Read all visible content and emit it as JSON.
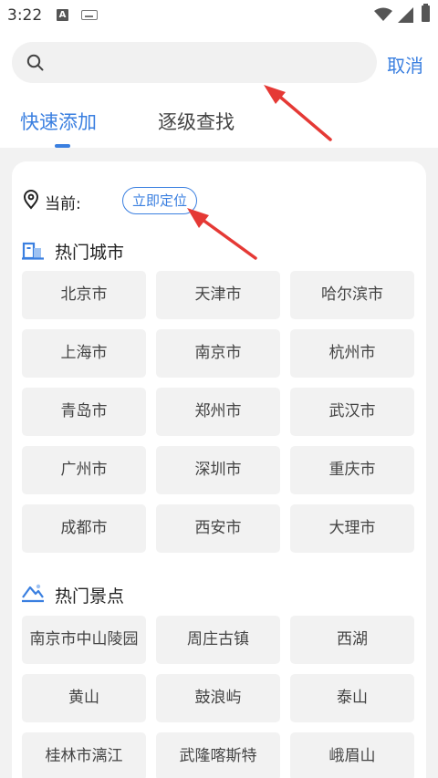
{
  "status_bar": {
    "time": "3:22",
    "notification_icon": "A"
  },
  "search": {
    "placeholder": "",
    "cancel_label": "取消"
  },
  "tabs": [
    {
      "label": "快速添加",
      "active": true
    },
    {
      "label": "逐级查找",
      "active": false
    }
  ],
  "location": {
    "label": "当前:",
    "locate_button": "立即定位"
  },
  "hot_cities": {
    "title": "热门城市",
    "items": [
      "北京市",
      "天津市",
      "哈尔滨市",
      "上海市",
      "南京市",
      "杭州市",
      "青岛市",
      "郑州市",
      "武汉市",
      "广州市",
      "深圳市",
      "重庆市",
      "成都市",
      "西安市",
      "大理市"
    ]
  },
  "hot_spots": {
    "title": "热门景点",
    "items": [
      "南京市中山陵园",
      "周庄古镇",
      "西湖",
      "黄山",
      "鼓浪屿",
      "泰山",
      "桂林市漓江",
      "武隆喀斯特",
      "峨眉山"
    ]
  },
  "colors": {
    "accent": "#3a7fe0",
    "annotation_arrow": "#e53935"
  },
  "icons": [
    "search-icon",
    "location-pin-icon",
    "building-icon",
    "mountain-icon",
    "wifi-icon",
    "signal-icon",
    "battery-icon",
    "keyboard-icon"
  ]
}
